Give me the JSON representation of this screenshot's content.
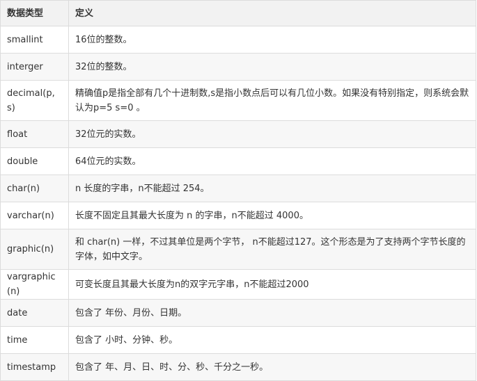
{
  "header": {
    "col_type": "数据类型",
    "col_def": "定义"
  },
  "rows": [
    {
      "type": "smallint",
      "def": "16位的整数。"
    },
    {
      "type": "interger",
      "def": "32位的整数。"
    },
    {
      "type": "decimal(p,s)",
      "def": "精确值p是指全部有几个十进制数,s是指小数点后可以有几位小数。如果没有特别指定，则系统会默认为p=5 s=0 。"
    },
    {
      "type": "float",
      "def": "32位元的实数。"
    },
    {
      "type": "double",
      "def": "64位元的实数。"
    },
    {
      "type": "char(n)",
      "def": "n 长度的字串，n不能超过 254。"
    },
    {
      "type": "varchar(n)",
      "def": "长度不固定且其最大长度为 n 的字串，n不能超过 4000。"
    },
    {
      "type": "graphic(n)",
      "def": "和 char(n) 一样，不过其单位是两个字节， n不能超过127。这个形态是为了支持两个字节长度的字体，如中文字。"
    },
    {
      "type": "vargraphic(n)",
      "def": "可变长度且其最大长度为n的双字元字串，n不能超过2000"
    },
    {
      "type": "date",
      "def": "包含了 年份、月份、日期。"
    },
    {
      "type": "time",
      "def": "包含了 小时、分钟、秒。"
    },
    {
      "type": "timestamp",
      "def": "包含了 年、月、日、时、分、秒、千分之一秒。"
    }
  ]
}
